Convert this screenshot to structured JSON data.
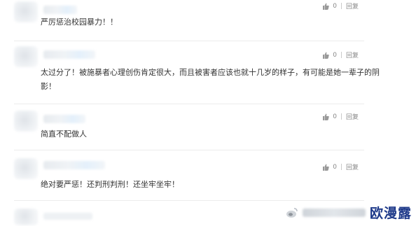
{
  "actions_template": {
    "like_count": "0",
    "reply_label": "回复"
  },
  "comments": [
    {
      "text": "严厉惩治校园暴力！！",
      "likes": "0",
      "reply": "回复"
    },
    {
      "text_line1": "太过分了！被施暴者心理创伤肯定很大，而且被害者应该也就十几岁的样子，有可能是她一辈子的阴",
      "text_line2": "影！",
      "likes": "0",
      "reply": "回复"
    },
    {
      "text": "简直不配做人",
      "likes": "0",
      "reply": "回复"
    },
    {
      "text": "绝对要严惩！还判刑判刑！还坐牢坐牢！",
      "likes": "0",
      "reply": "回复"
    }
  ],
  "watermark": {
    "brand": "欧漫露"
  },
  "colors": {
    "brand": "#1e3a8a",
    "text": "#333333",
    "meta": "#888888"
  }
}
